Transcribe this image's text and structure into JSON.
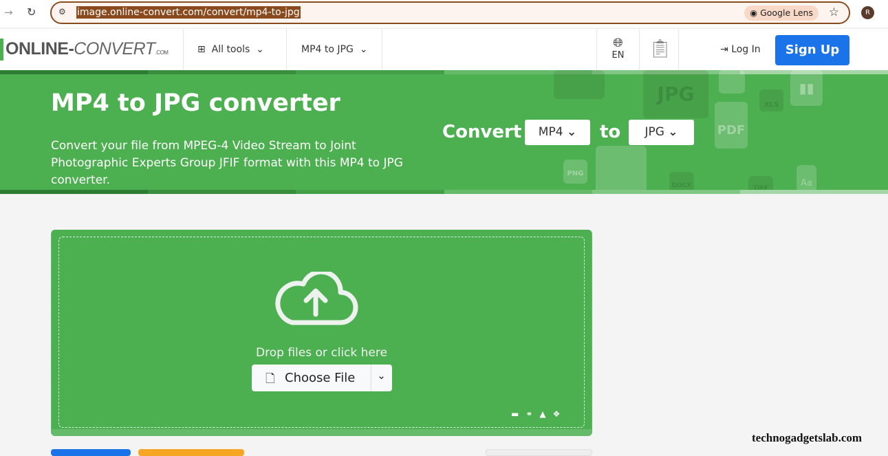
{
  "browser": {
    "url": "image.online-convert.com/convert/mp4-to-jpg",
    "lens_label": "Google Lens",
    "avatar_initial": "R"
  },
  "header": {
    "logo_main": "ONLINE-",
    "logo_accent": "CONVERT",
    "logo_suffix": ".COM",
    "all_tools": "All tools",
    "current_tool": "MP4 to JPG",
    "language": "EN",
    "login": "Log In",
    "signup": "Sign Up"
  },
  "hero": {
    "title": "MP4 to JPG converter",
    "description": "Convert your file from MPEG-4 Video Stream to Joint Photographic Experts Group JFIF format with this MP4 to JPG converter.",
    "convert_label": "Convert",
    "from_format": "MP4",
    "to_label": "to",
    "to_format": "JPG",
    "bg_icons": [
      "JPG",
      "PDF",
      "XLS",
      "PNG",
      "DOCX",
      "TIFF",
      "Aa"
    ]
  },
  "upload": {
    "drop_text": "Drop files or click here",
    "choose_file": "Choose File"
  },
  "watermark": "technogadgetslab.com",
  "colors": {
    "green": "#4caf50",
    "blue": "#1a73e8",
    "address_border": "#8b4a1e"
  }
}
